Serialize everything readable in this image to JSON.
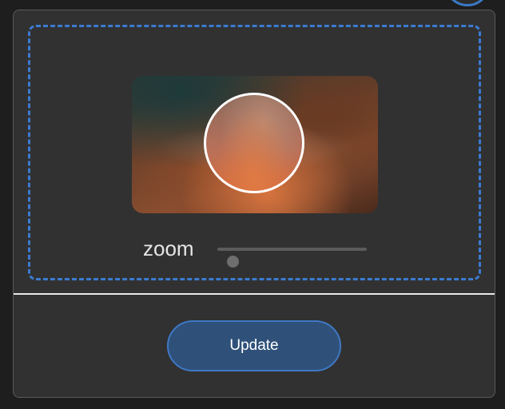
{
  "zoom": {
    "label": "zoom",
    "value": 0.1
  },
  "actions": {
    "update_label": "Update"
  },
  "colors": {
    "accent": "#3b7bd1",
    "button_bg": "#2f5179",
    "dialog_bg": "#313131"
  }
}
